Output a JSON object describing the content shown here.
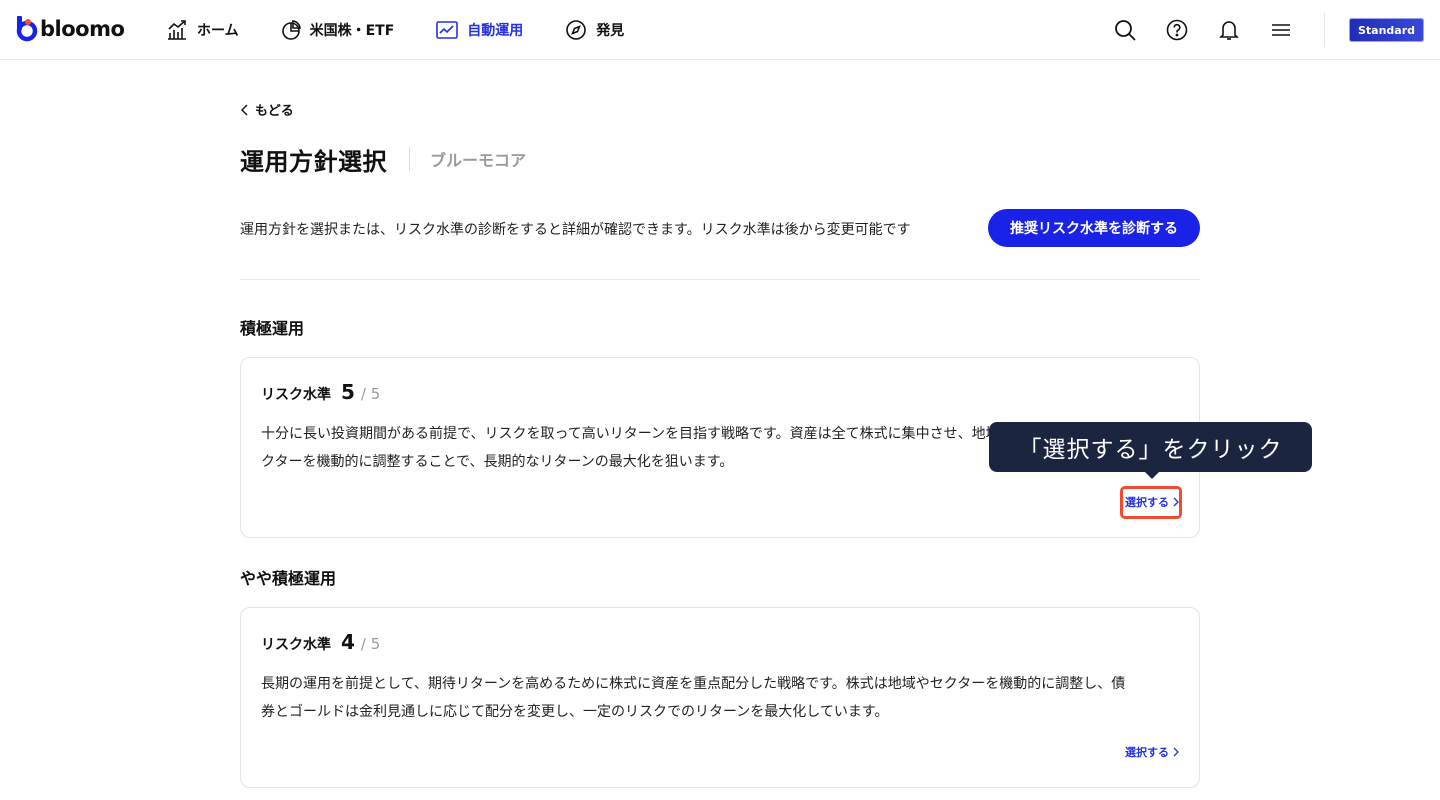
{
  "header": {
    "logo_text": "bloomo",
    "nav": [
      {
        "label": "ホーム",
        "icon": "chart-growth-icon"
      },
      {
        "label": "米国株・ETF",
        "icon": "pie-chart-icon"
      },
      {
        "label": "自動運用",
        "icon": "line-chart-icon",
        "active": true
      },
      {
        "label": "発見",
        "icon": "compass-icon"
      }
    ],
    "plan_badge": "Standard"
  },
  "main": {
    "back_label": "もどる",
    "title": "運用方針選択",
    "subtitle": "ブルーモコア",
    "description": "運用方針を選択または、リスク水準の診断をすると詳細が確認できます。リスク水準は後から変更可能です",
    "diagnose_button": "推奨リスク水準を診断する"
  },
  "sections": [
    {
      "title": "積極運用",
      "risk_label": "リスク水準",
      "risk_level": "5",
      "risk_max": "/ 5",
      "text_line1": "十分に長い投資期間がある前提で、リスクを取って高いリターンを目指す戦略です。資産は全て株式に集中させ、地域やセ",
      "text_line2": "クターを機動的に調整することで、長期的なリターンの最大化を狙います。",
      "select_label": "選択する"
    },
    {
      "title": "やや積極運用",
      "risk_label": "リスク水準",
      "risk_level": "4",
      "risk_max": "/ 5",
      "text_line1": "長期の運用を前提として、期待リターンを高めるために株式に資産を重点配分した戦略です。株式は地域やセクターを機動的に調整し、債",
      "text_line2": "券とゴールドは金利見通しに応じて配分を変更し、一定のリスクでのリターンを最大化しています。",
      "select_label": "選択する"
    }
  ],
  "annotation": {
    "tooltip": "「選択する」をクリック",
    "highlight_color": "#f04b33"
  },
  "colors": {
    "accent": "#2431e5",
    "button": "#1a22e8",
    "tooltip_bg": "#1c2540"
  }
}
